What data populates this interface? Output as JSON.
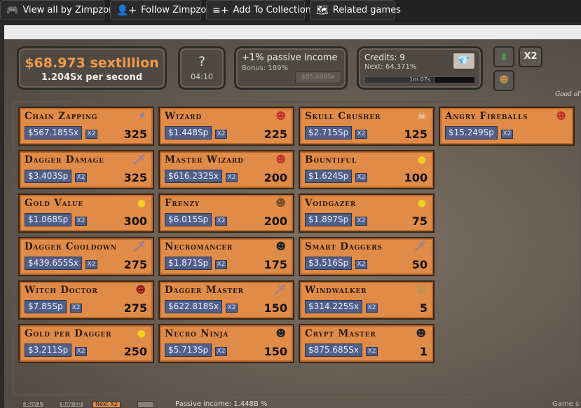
{
  "topbar": {
    "buttons": [
      {
        "label": "View all by Zimpzon",
        "icon": "itch-icon",
        "glyph": "🎮"
      },
      {
        "label": "Follow Zimpzon",
        "icon": "follow-user-icon",
        "glyph": "👤+"
      },
      {
        "label": "Add To Collection",
        "icon": "playlist-add-icon",
        "glyph": "≡+"
      },
      {
        "label": "Related games",
        "icon": "map-icon",
        "glyph": "🗺"
      }
    ]
  },
  "stats": {
    "money": "$68.973 sextillion",
    "rate": "1.204Sx per second",
    "mystery_symbol": "?",
    "mystery_timer": "04:10",
    "passive_title": "+1% passive income",
    "passive_bonus": "Bonus: 189%",
    "passive_cost": "$85.498Sx",
    "credits": "Credits: 9",
    "credits_next": "Next: 64.371%",
    "credits_timer": "1m 07s",
    "credits_progress": 0.64371,
    "gem_glyph": "💎",
    "x2_label": "X2",
    "flavor_text": "Good ol' D"
  },
  "footer": {
    "buy1": "Buy 1",
    "buy10": "Buy 10",
    "nextx2": "Next X2",
    "passive": "Passive income: 1.448B %",
    "game": "Game s"
  },
  "colors": {
    "card_bg": "#e08b47",
    "price_bg": "#4f5f88",
    "money": "#f29a4b"
  },
  "upgrades": [
    [
      {
        "name": "Chain Zapping",
        "price": "$567.185Sx",
        "x2": "X2",
        "count": "325",
        "icon": "lightning-icon",
        "glyph": "⚡",
        "color": "#2a7fff"
      },
      {
        "name": "Dagger Damage",
        "price": "$3.403Sp",
        "x2": "X2",
        "count": "325",
        "icon": "dagger-icon",
        "glyph": "🗡",
        "color": "#6677cc"
      },
      {
        "name": "Gold Value",
        "price": "$1.068Sp",
        "x2": "X2",
        "count": "300",
        "icon": "gold-coin-icon",
        "glyph": "●",
        "color": "#f0d020"
      },
      {
        "name": "Dagger Cooldown",
        "price": "$439.655Sx",
        "x2": "X2",
        "count": "275",
        "icon": "dagger-icon",
        "glyph": "🗡",
        "color": "#6677cc"
      },
      {
        "name": "Witch Doctor",
        "price": "$7.85Sp",
        "x2": "X2",
        "count": "275",
        "icon": "witch-doctor-icon",
        "glyph": "☻",
        "color": "#8b1a1a"
      },
      {
        "name": "Gold per Dagger",
        "price": "$3.211Sp",
        "x2": "X2",
        "count": "250",
        "icon": "gold-coin-icon",
        "glyph": "●",
        "color": "#f0d020"
      }
    ],
    [
      {
        "name": "Wizard",
        "price": "$1.448Sp",
        "x2": "X2",
        "count": "225",
        "icon": "wizard-icon",
        "glyph": "☻",
        "color": "#c43030"
      },
      {
        "name": "Master Wizard",
        "price": "$616.232Sx",
        "x2": "X2",
        "count": "200",
        "icon": "wizard-icon",
        "glyph": "☻",
        "color": "#c43030"
      },
      {
        "name": "Frenzy",
        "price": "$6.015Sp",
        "x2": "X2",
        "count": "200",
        "icon": "frenzy-face-icon",
        "glyph": "☻",
        "color": "#7a4a20"
      },
      {
        "name": "Necromancer",
        "price": "$1.871Sp",
        "x2": "X2",
        "count": "175",
        "icon": "skull-mask-icon",
        "glyph": "☻",
        "color": "#222222"
      },
      {
        "name": "Dagger Master",
        "price": "$622.818Sx",
        "x2": "X2",
        "count": "150",
        "icon": "dagger-icon",
        "glyph": "🗡",
        "color": "#6677cc"
      },
      {
        "name": "Necro Ninja",
        "price": "$5.713Sp",
        "x2": "X2",
        "count": "150",
        "icon": "skull-mask-icon",
        "glyph": "☻",
        "color": "#222222"
      }
    ],
    [
      {
        "name": "Skull Crusher",
        "price": "$2.715Sp",
        "x2": "X2",
        "count": "125",
        "icon": "skull-icon",
        "glyph": "☠",
        "color": "#eeeeee"
      },
      {
        "name": "Bountiful",
        "price": "$1.624Sp",
        "x2": "X2",
        "count": "100",
        "icon": "gold-coin-icon",
        "glyph": "●",
        "color": "#f0d020"
      },
      {
        "name": "Voidgazer",
        "price": "$1.897Sp",
        "x2": "X2",
        "count": "75",
        "icon": "gold-coin-icon",
        "glyph": "●",
        "color": "#f0d020"
      },
      {
        "name": "Smart Daggers",
        "price": "$3.516Sp",
        "x2": "X2",
        "count": "50",
        "icon": "dagger-icon",
        "glyph": "🗡",
        "color": "#6677cc"
      },
      {
        "name": "Windwalker",
        "price": "$314.225Sx",
        "x2": "X2",
        "count": "5",
        "icon": "windwalker-face-icon",
        "glyph": "☻",
        "color": "#c09050"
      },
      {
        "name": "Crypt Master",
        "price": "$875.685Sx",
        "x2": "X2",
        "count": "1",
        "icon": "skull-mask-icon",
        "glyph": "☻",
        "color": "#222222"
      }
    ],
    [
      {
        "name": "Angry Fireballs",
        "price": "$15.249Sp",
        "x2": "X2",
        "count": "",
        "icon": "wizard-icon",
        "glyph": "☻",
        "color": "#c43030"
      }
    ]
  ]
}
